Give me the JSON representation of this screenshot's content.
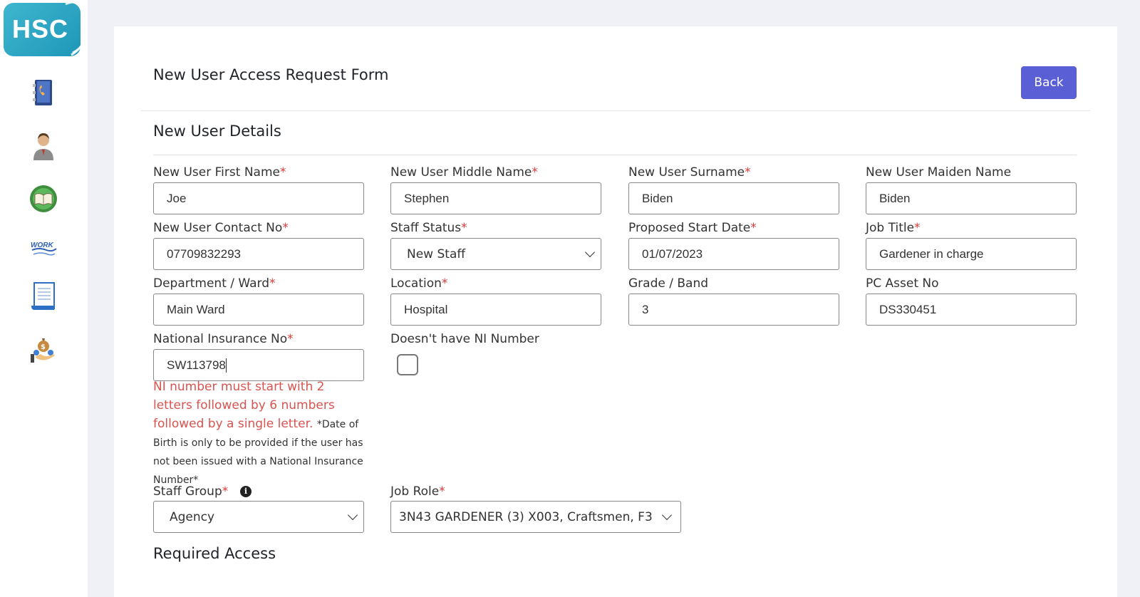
{
  "sidebar": {
    "logo_text": "HSC",
    "items": [
      {
        "icon": "phonebook-icon"
      },
      {
        "icon": "user-icon"
      },
      {
        "icon": "book-icon"
      },
      {
        "icon": "work-icon",
        "text": "WORK"
      },
      {
        "icon": "document-icon"
      },
      {
        "icon": "money-hand-icon"
      }
    ]
  },
  "header": {
    "title": "New User Access Request Form",
    "back_label": "Back"
  },
  "section": {
    "title": "New User Details"
  },
  "fields": {
    "first_name": {
      "label": "New User First Name",
      "required": "*",
      "value": "Joe"
    },
    "middle_name": {
      "label": "New User Middle Name",
      "required": "*",
      "value": "Stephen"
    },
    "surname": {
      "label": "New User Surname",
      "required": "*",
      "value": "Biden"
    },
    "maiden_name": {
      "label": "New User Maiden Name",
      "value": "Biden"
    },
    "contact_no": {
      "label": "New User Contact No",
      "required": "*",
      "value": "07709832293"
    },
    "staff_status": {
      "label": "Staff Status",
      "required": "*",
      "value": "New Staff"
    },
    "start_date": {
      "label": "Proposed Start Date",
      "required": "*",
      "value": "01/07/2023"
    },
    "job_title": {
      "label": "Job Title",
      "required": "*",
      "value": "Gardener in charge"
    },
    "department": {
      "label": "Department / Ward",
      "required": "*",
      "value": "Main Ward"
    },
    "location": {
      "label": "Location",
      "required": "*",
      "value": "Hospital"
    },
    "grade": {
      "label": "Grade / Band",
      "value": "3"
    },
    "pc_asset": {
      "label": "PC Asset No",
      "value": "DS330451"
    },
    "ni_number": {
      "label": "National Insurance No",
      "required": "*",
      "value": "SW113798"
    },
    "no_ni": {
      "label": "Doesn't have NI Number"
    },
    "staff_group": {
      "label": "Staff Group",
      "required": "*",
      "value": "Agency"
    },
    "job_role": {
      "label": "Job Role",
      "required": "*",
      "value": "3N43 GARDENER (3) X003, Craftsmen, F3"
    }
  },
  "ni_error": "NI number must start with 2 letters followed by 6 numbers followed by a single letter.",
  "ni_note": "*Date of Birth is only to be provided if the user has not been issued with a National Insurance Number*",
  "required_access": {
    "title": "Required Access"
  }
}
